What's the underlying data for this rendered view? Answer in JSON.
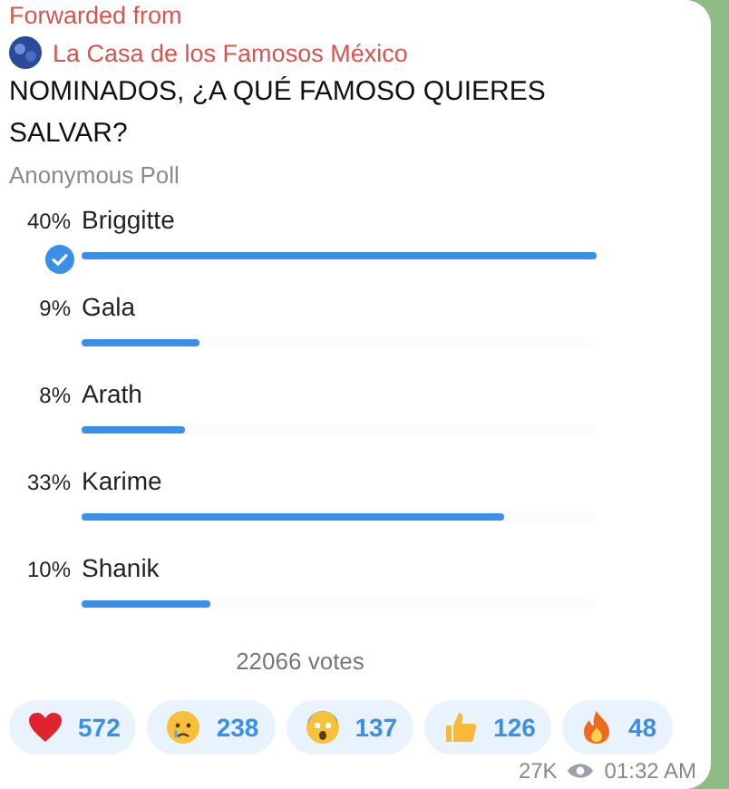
{
  "message": {
    "forwarded_label": "Forwarded from",
    "channel": "La Casa de los Famosos México",
    "question": "NOMINADOS, ¿A QUÉ FAMOSO QUIERES SALVAR?",
    "poll_type": "Anonymous Poll",
    "options": [
      {
        "percent": "40%",
        "name": "Briggitte",
        "level": 1.0,
        "selected": true
      },
      {
        "percent": "9%",
        "name": "Gala",
        "level": 0.23,
        "selected": false
      },
      {
        "percent": "8%",
        "name": "Arath",
        "level": 0.2,
        "selected": false
      },
      {
        "percent": "33%",
        "name": "Karime",
        "level": 0.82,
        "selected": false
      },
      {
        "percent": "10%",
        "name": "Shanik",
        "level": 0.25,
        "selected": false
      }
    ],
    "votes": "22066 votes",
    "reactions": [
      {
        "kind": "heart",
        "count": "572"
      },
      {
        "kind": "crying",
        "count": "238"
      },
      {
        "kind": "screaming",
        "count": "137"
      },
      {
        "kind": "thumbsup",
        "count": "126"
      },
      {
        "kind": "fire",
        "count": "48"
      }
    ],
    "views": "27K",
    "time": "01:32 AM"
  }
}
